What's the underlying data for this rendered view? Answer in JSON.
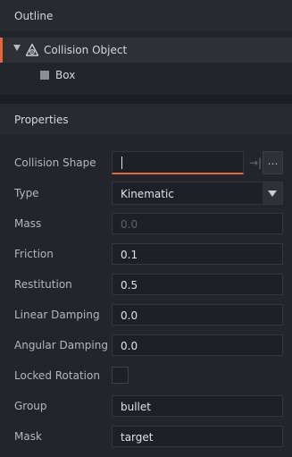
{
  "outline": {
    "title": "Outline",
    "items": [
      {
        "label": "Collision Object",
        "icon": "game-object-icon",
        "expanded": true,
        "selected": true
      },
      {
        "label": "Box",
        "icon": "box-icon"
      }
    ]
  },
  "properties": {
    "title": "Properties",
    "collision_shape": {
      "label": "Collision Shape",
      "value": "",
      "browse_label": "…",
      "link_icon": "→|"
    },
    "type": {
      "label": "Type",
      "value": "Kinematic"
    },
    "mass": {
      "label": "Mass",
      "placeholder": "0.0"
    },
    "friction": {
      "label": "Friction",
      "value": "0.1"
    },
    "restitution": {
      "label": "Restitution",
      "value": "0.5"
    },
    "linear_damping": {
      "label": "Linear Damping",
      "value": "0.0"
    },
    "angular_damping": {
      "label": "Angular Damping",
      "value": "0.0"
    },
    "locked_rotation": {
      "label": "Locked Rotation",
      "checked": false
    },
    "group": {
      "label": "Group",
      "value": "bullet"
    },
    "mask": {
      "label": "Mask",
      "value": "target"
    }
  },
  "colors": {
    "accent": "#e16a3c",
    "background": "#22252b",
    "field_background": "#1e2025"
  }
}
